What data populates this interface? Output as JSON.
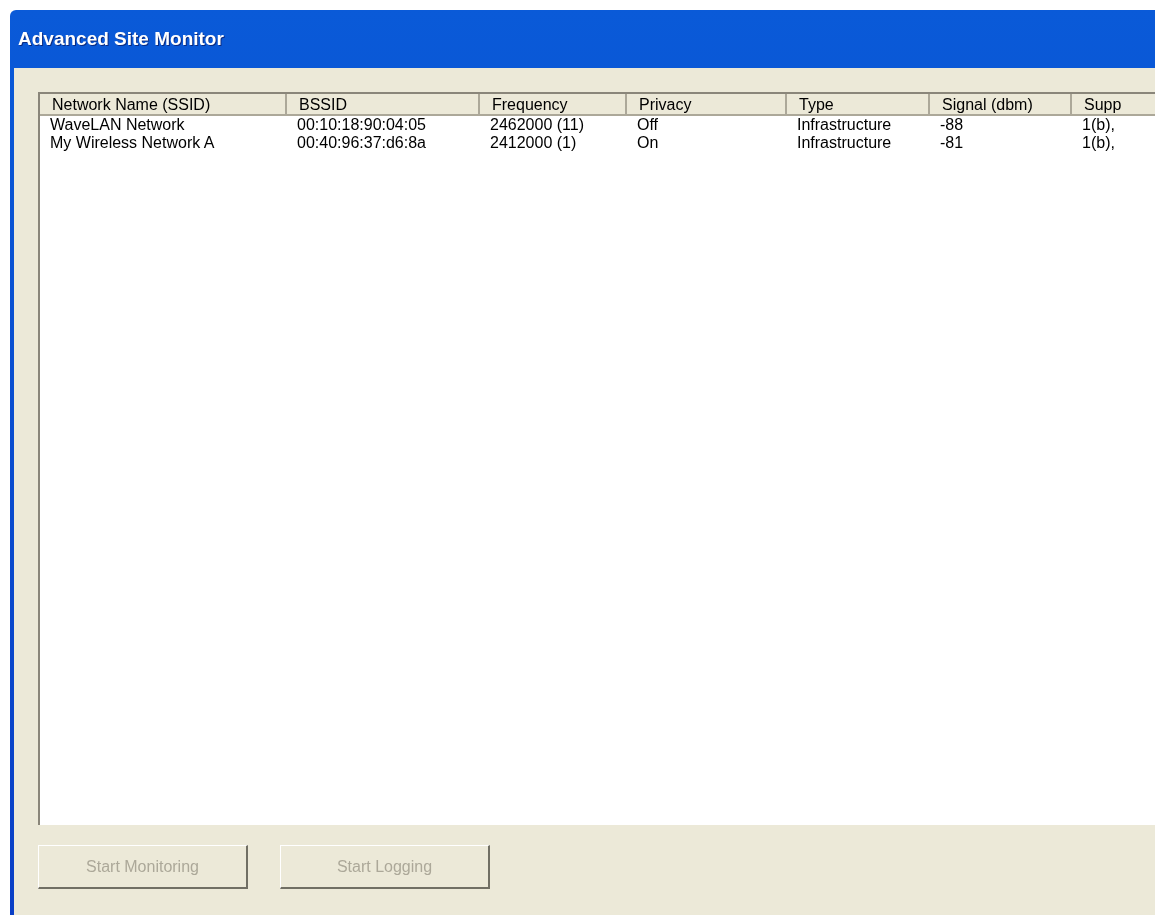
{
  "window": {
    "title": "Advanced Site Monitor"
  },
  "table": {
    "columns": [
      "Network Name (SSID)",
      "BSSID",
      "Frequency",
      "Privacy",
      "Type",
      "Signal (dbm)",
      "Supp"
    ],
    "rows": [
      [
        "WaveLAN Network",
        "00:10:18:90:04:05",
        "2462000 (11)",
        "Off",
        "Infrastructure",
        "-88",
        "1(b),"
      ],
      [
        "My Wireless Network A",
        "00:40:96:37:d6:8a",
        "2412000 (1)",
        "On",
        "Infrastructure",
        "-81",
        "1(b),"
      ]
    ]
  },
  "buttons": [
    {
      "label": "Start Monitoring",
      "disabled": true
    },
    {
      "label": "Start Logging",
      "disabled": true
    }
  ]
}
